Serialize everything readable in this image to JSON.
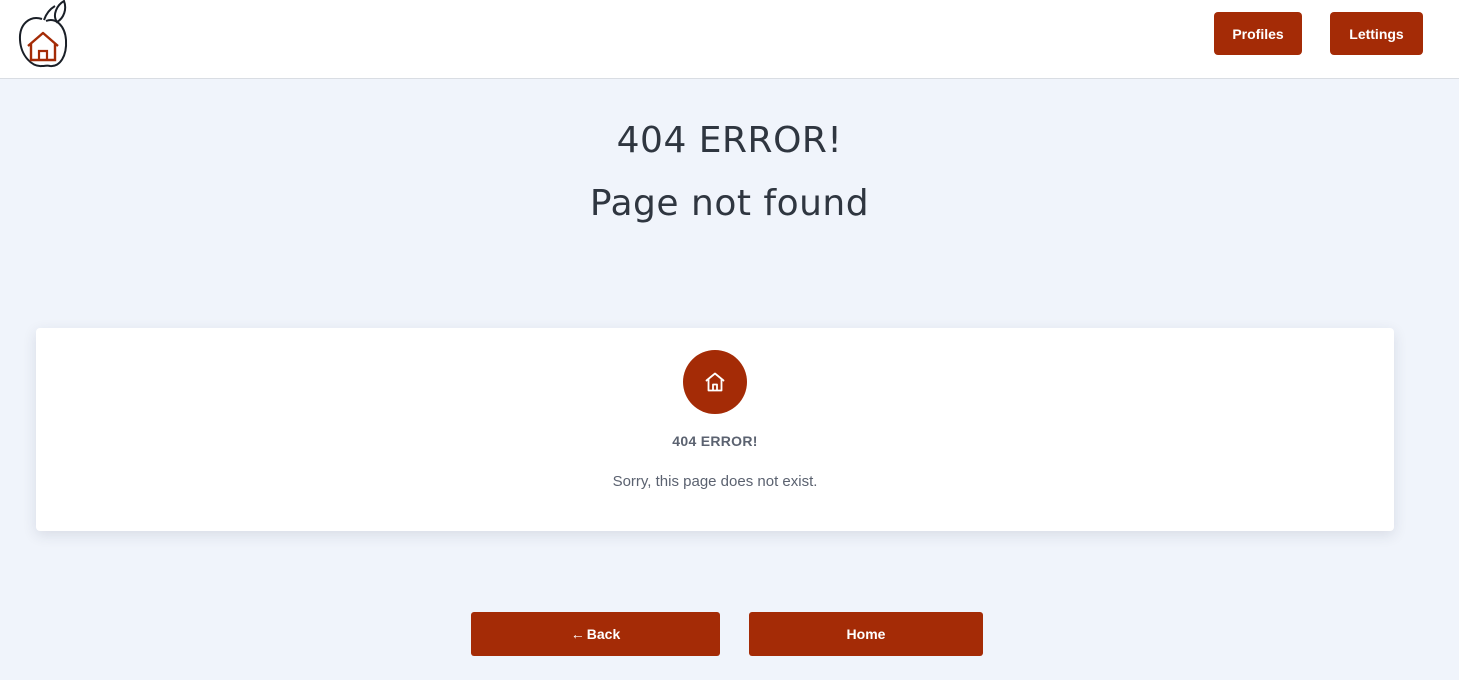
{
  "header": {
    "logo_icon": "house-in-apple-logo",
    "nav": {
      "profiles_label": "Profiles",
      "lettings_label": "Lettings"
    }
  },
  "main": {
    "heading_line1": "404 ERROR!",
    "heading_line2": "Page not found"
  },
  "card": {
    "icon": "home-icon",
    "title": "404 ERROR!",
    "message": "Sorry, this page does not exist."
  },
  "actions": {
    "back_arrow": "←",
    "back_label": "Back",
    "home_label": "Home"
  },
  "colors": {
    "accent": "#a42b06",
    "background": "#f0f4fb",
    "card": "#ffffff",
    "text_dark": "#2f3640",
    "text_muted": "#5b6270"
  }
}
